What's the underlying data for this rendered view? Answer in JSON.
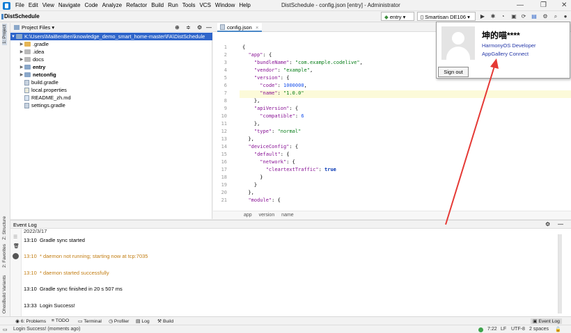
{
  "window": {
    "title": "DistSchedule - config.json [entry] - Administrator",
    "menu": [
      "File",
      "Edit",
      "View",
      "Navigate",
      "Code",
      "Analyze",
      "Refactor",
      "Build",
      "Run",
      "Tools",
      "VCS",
      "Window",
      "Help"
    ]
  },
  "navbar": {
    "project_title": "DistSchedule",
    "run_config": "entry",
    "device": "Smartisan DE106"
  },
  "left_strip": {
    "project": "1: Project",
    "structure": "Z: Structure",
    "favorites": "2: Favorites",
    "build_variants": "OhosBuild Variants"
  },
  "project": {
    "header": "Project Files",
    "tree": [
      {
        "label": "K:\\Users\\MaiBenBen\\knowledge_demo_smart_home-master\\FA\\DistSchedule",
        "type": "folder",
        "bold": false,
        "expanded": true,
        "selected": true
      },
      {
        "label": ".gradle",
        "type": "folder",
        "bold": false
      },
      {
        "label": ".idea",
        "type": "folder",
        "bold": false
      },
      {
        "label": "docs",
        "type": "folder",
        "bold": false
      },
      {
        "label": "entry",
        "type": "folder",
        "bold": true
      },
      {
        "label": "netconfig",
        "type": "folder",
        "bold": true
      },
      {
        "label": "build.gradle",
        "type": "file"
      },
      {
        "label": "local.properties",
        "type": "file"
      },
      {
        "label": "README_zh.md",
        "type": "file"
      },
      {
        "label": "settings.gradle",
        "type": "file"
      }
    ]
  },
  "editor": {
    "tab": "config.json",
    "line_numbers": [
      "1",
      "2",
      "3",
      "4",
      "5",
      "6",
      "7",
      "8",
      "9",
      "10",
      "11",
      "12",
      "13",
      "14",
      "15",
      "16",
      "17",
      "18",
      "19",
      "20",
      "21"
    ],
    "highlighted_line": 7,
    "breadcrumb": [
      "app",
      "version",
      "name"
    ]
  },
  "event_log": {
    "title": "Event Log",
    "entries": [
      {
        "time": "",
        "text": "2022/3/17",
        "style": "normal"
      },
      {
        "time": "13:10",
        "text": "Gradle sync started",
        "style": "normal"
      },
      {
        "time": "13:10",
        "text": "* daemon not running; starting now at tcp:7035",
        "style": "warn"
      },
      {
        "time": "13:10",
        "text": "* daemon started successfully",
        "style": "warn"
      },
      {
        "time": "13:10",
        "text": "Gradle sync finished in 20 s 507 ms",
        "style": "normal"
      },
      {
        "time": "13:33",
        "text": "Login Success!",
        "style": "normal"
      }
    ]
  },
  "tool_tabs": {
    "problems": "6: Problems",
    "todo": "TODO",
    "terminal": "Terminal",
    "profiler": "Profiler",
    "log": "Log",
    "build": "Build",
    "event_log": "Event Log"
  },
  "status": {
    "message": "Login Success! (moments ago)",
    "position": "7:22",
    "line_sep": "LF",
    "encoding": "UTF-8",
    "indent": "2 spaces"
  },
  "account_popup": {
    "name": "坤的喵****",
    "line1": "HarmonyOS Developer",
    "line2": "AppGallery Connect",
    "sign_out": "Sign out"
  },
  "colors": {
    "accent_selection": "#2f65ca",
    "link_blue": "#2437a8",
    "warning": "#c27d12",
    "arrow": "#e53935"
  }
}
